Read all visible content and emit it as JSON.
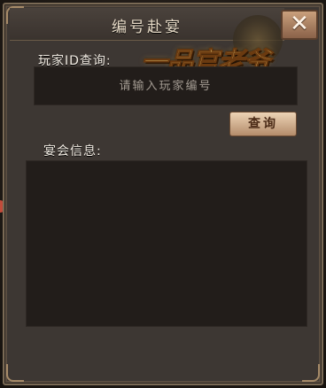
{
  "dialog": {
    "title": "编号赴宴",
    "close_label": "✕"
  },
  "logo": {
    "text": "一品官老爷"
  },
  "query": {
    "label": "玩家ID查询:",
    "input_placeholder": "请输入玩家编号",
    "input_value": "",
    "button_label": "查询"
  },
  "banquet_info": {
    "label": "宴会信息:"
  },
  "colors": {
    "panel": "#3d3733",
    "field": "#221d1a",
    "accent_gold": "#f7d77a",
    "button": "#d9b896"
  }
}
